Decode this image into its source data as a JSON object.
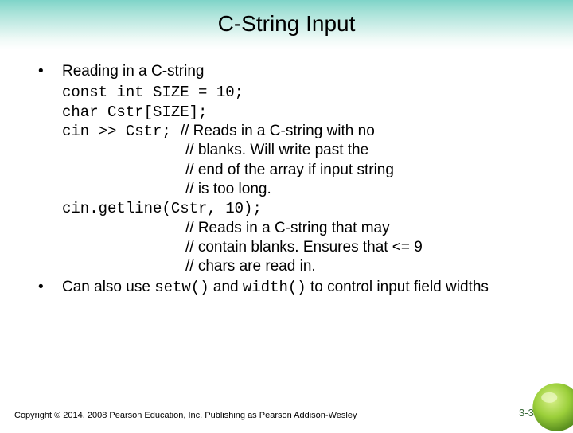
{
  "title": "C-String Input",
  "bullets": {
    "b1": "Reading in a C-string",
    "b2_pre": "Can also use ",
    "b2_c1": "setw()",
    "b2_mid": " and ",
    "b2_c2": "width()",
    "b2_post": " to control input field widths"
  },
  "code": {
    "l1": "const int SIZE = 10;",
    "l2": "char Cstr[SIZE];",
    "l3": "cin >> Cstr;",
    "l4": "cin.getline(Cstr, 10);"
  },
  "comments": {
    "c1a": "// Reads in a C-string with no",
    "c1b": "// blanks. Will write past the",
    "c1c": "// end of the array if input string",
    "c1d": "// is too long.",
    "c2a": "// Reads in a C-string that may",
    "c2b": "// contain blanks. Ensures that <= 9",
    "c2c": "// chars are read in."
  },
  "footer": "Copyright © 2014, 2008 Pearson Education, Inc. Publishing as Pearson Addison-Wesley",
  "pagenum": "3-39"
}
